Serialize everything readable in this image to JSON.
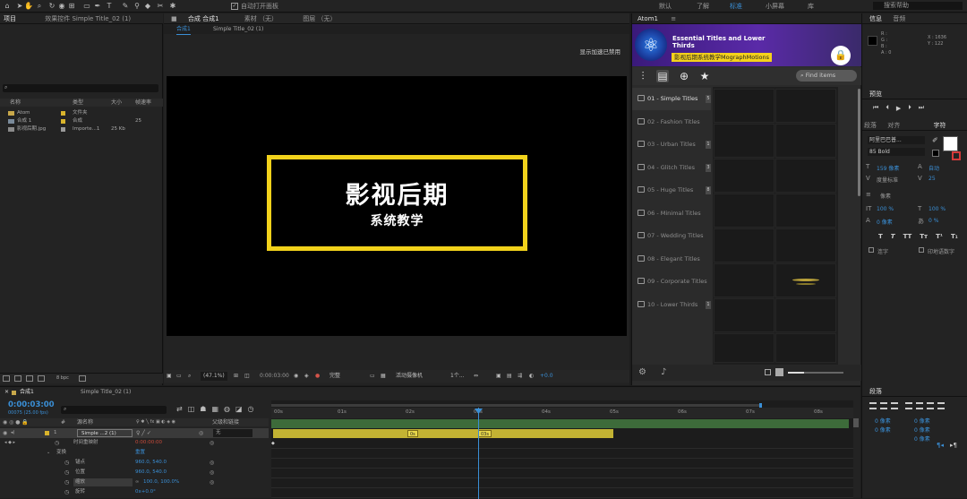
{
  "toolbar": {
    "auto_open": "自动打开面板",
    "workspaces": [
      "默认",
      "了解",
      "标准",
      "小屏幕",
      "库"
    ],
    "search_help": "搜索帮助"
  },
  "project": {
    "tab": "项目",
    "tab_effects": "效果控件 Simple Title_02 (1)",
    "columns": [
      "名称",
      "类型",
      "大小",
      "帧速率"
    ],
    "rows": [
      {
        "name": "Atom",
        "type": "文件夹",
        "size": "",
        "icon": "folder-icon",
        "color": "#d9b42c"
      },
      {
        "name": "合成 1",
        "type": "合成",
        "size": "25",
        "icon": "comp-icon",
        "color": "#d9b42c"
      },
      {
        "name": "影视后期.jpg",
        "type": "Importe...1",
        "size": "25 Kb",
        "icon": "image-icon",
        "color": "#9a9a9a"
      }
    ],
    "bpc": "8 bpc"
  },
  "comp": {
    "tab_label": "合成 合成1",
    "layer_tab": "图层 （无）",
    "footage_tab": "素材 （无）",
    "subtab1": "合成1",
    "subtab2": "Simple Title_02 (1)",
    "notice": "显示加速已禁用",
    "title_main": "影视后期",
    "title_sub": "系统教学",
    "zoom": "(47.1%)",
    "time": "0:00:03:00",
    "quality": "完整",
    "camera": "活动摄像机",
    "views": "1个...",
    "exposure": "+0.0"
  },
  "atom": {
    "panel": "Atom1",
    "title": "Essential Titles and Lower Thirds",
    "tag": "影视后期系统教学MographMotions",
    "search_placeholder": "Find items",
    "items": [
      {
        "label": "01 - Simple Titles",
        "badge": "5",
        "active": true
      },
      {
        "label": "02 - Fashion Titles",
        "badge": ""
      },
      {
        "label": "03 - Urban Titles",
        "badge": "1"
      },
      {
        "label": "04 - Glitch Titles",
        "badge": "3"
      },
      {
        "label": "05 - Huge Titles",
        "badge": "8"
      },
      {
        "label": "06 - Minimal Titles",
        "badge": ""
      },
      {
        "label": "07 - Wedding Titles",
        "badge": ""
      },
      {
        "label": "08 - Elegant Titles",
        "badge": ""
      },
      {
        "label": "09 - Corporate Titles",
        "badge": ""
      },
      {
        "label": "10 - Lower Thirds",
        "badge": "1"
      }
    ]
  },
  "info": {
    "tab": "信息",
    "audio": "音频",
    "r": "R :",
    "g": "G :",
    "b": "B :",
    "a": "A : 0",
    "x": "X : 1636",
    "y": "Y : 122"
  },
  "preview": {
    "tab": "预览"
  },
  "character": {
    "tabs": [
      "段落",
      "对齐",
      "字符"
    ],
    "font": "阿里巴巴普...",
    "style": "85 Bold",
    "size": "159 像素",
    "leading": "自动",
    "kerning": "度量标准",
    "tracking": "25",
    "stroke": "像素",
    "vscale": "100 %",
    "hscale": "100 %",
    "baseline": "0 像素",
    "tsume": "0 %",
    "ligature": "连字",
    "hindi": "印地语数字"
  },
  "paragraph": {
    "tab": "段落",
    "indent1": "0 像素",
    "indent2": "0 像素",
    "indent3": "0 像素",
    "space1": "0 像素",
    "space2": "0 像素"
  },
  "timeline": {
    "tab": "合成1",
    "tab2": "Simple Title_02 (1)",
    "time": "0:00:03:00",
    "fps": "00075 (25.00 fps)",
    "columns": [
      "#",
      "源名称",
      "父级和链接"
    ],
    "ruler": [
      "00s",
      "01s",
      "02s",
      "03s",
      "04s",
      "05s",
      "06s",
      "07s",
      "08s"
    ],
    "layers": [
      {
        "num": "1",
        "name": "Simple ...2 (1)",
        "parent": "无"
      },
      {
        "num": "",
        "name": "时间重映射",
        "value": "0:00:00:00"
      },
      {
        "num": "",
        "name": "变换",
        "value": "重置"
      },
      {
        "num": "",
        "name": "锚点",
        "value": "960.0, 540.0"
      },
      {
        "num": "",
        "name": "位置",
        "value": "960.0, 540.0"
      },
      {
        "num": "",
        "name": "缩放",
        "value": "100.0, 100.0%"
      },
      {
        "num": "",
        "name": "旋转",
        "value": "0x+0.0°"
      }
    ],
    "marker_in": "0s",
    "marker_out": "03s"
  }
}
